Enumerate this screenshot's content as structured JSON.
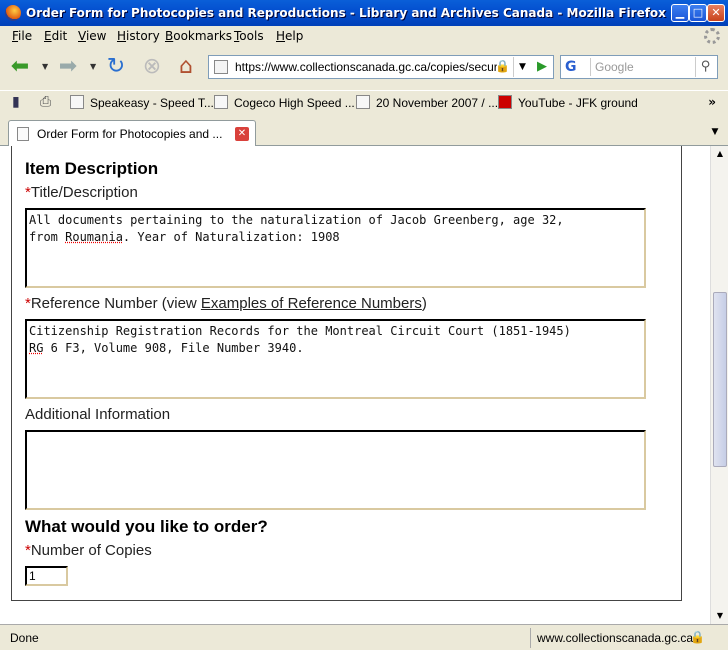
{
  "window": {
    "title": "Order Form for Photocopies and Reproductions - Library and Archives Canada - Mozilla Firefox"
  },
  "menu": [
    "File",
    "Edit",
    "View",
    "History",
    "Bookmarks",
    "Tools",
    "Help"
  ],
  "navigation": {
    "url": "https://www.collectionscanada.gc.ca/copies/secure",
    "search_placeholder": "Google",
    "search_engine_letter": "G"
  },
  "bookmarks": [
    {
      "label": "Speakeasy - Speed T..."
    },
    {
      "label": "Cogeco High Speed ..."
    },
    {
      "label": "20 November 2007 / ..."
    },
    {
      "label": "YouTube - JFK ground"
    }
  ],
  "tab": {
    "label": "Order Form for Photocopies and ..."
  },
  "form": {
    "item_section_title": "Item Description",
    "required_mark": "*",
    "title_label": "Title/Description",
    "title_value_line1": "All documents pertaining to the naturalization of Jacob Greenberg, age 32,",
    "title_value_line2_pre": "from ",
    "title_value_line2_misspelled": "Roumania",
    "title_value_line2_post": ". Year of Naturalization: 1908",
    "reference_label_pre": "Reference Number (view ",
    "reference_label_link": "Examples of Reference Numbers",
    "reference_label_post": ")",
    "reference_value_line1": "Citizenship Registration Records for the Montreal Circuit Court (1851-1945)",
    "reference_value_line2_misspelled": "RG",
    "reference_value_line2_post": " 6 F3, Volume 908, File Number 3940.",
    "additional_label": "Additional Information",
    "additional_value": "",
    "order_section_title": "What would you like to order?",
    "copies_label": "Number of Copies",
    "copies_value": "1"
  },
  "status": {
    "text": "Done",
    "host": "www.collectionscanada.gc.ca"
  }
}
